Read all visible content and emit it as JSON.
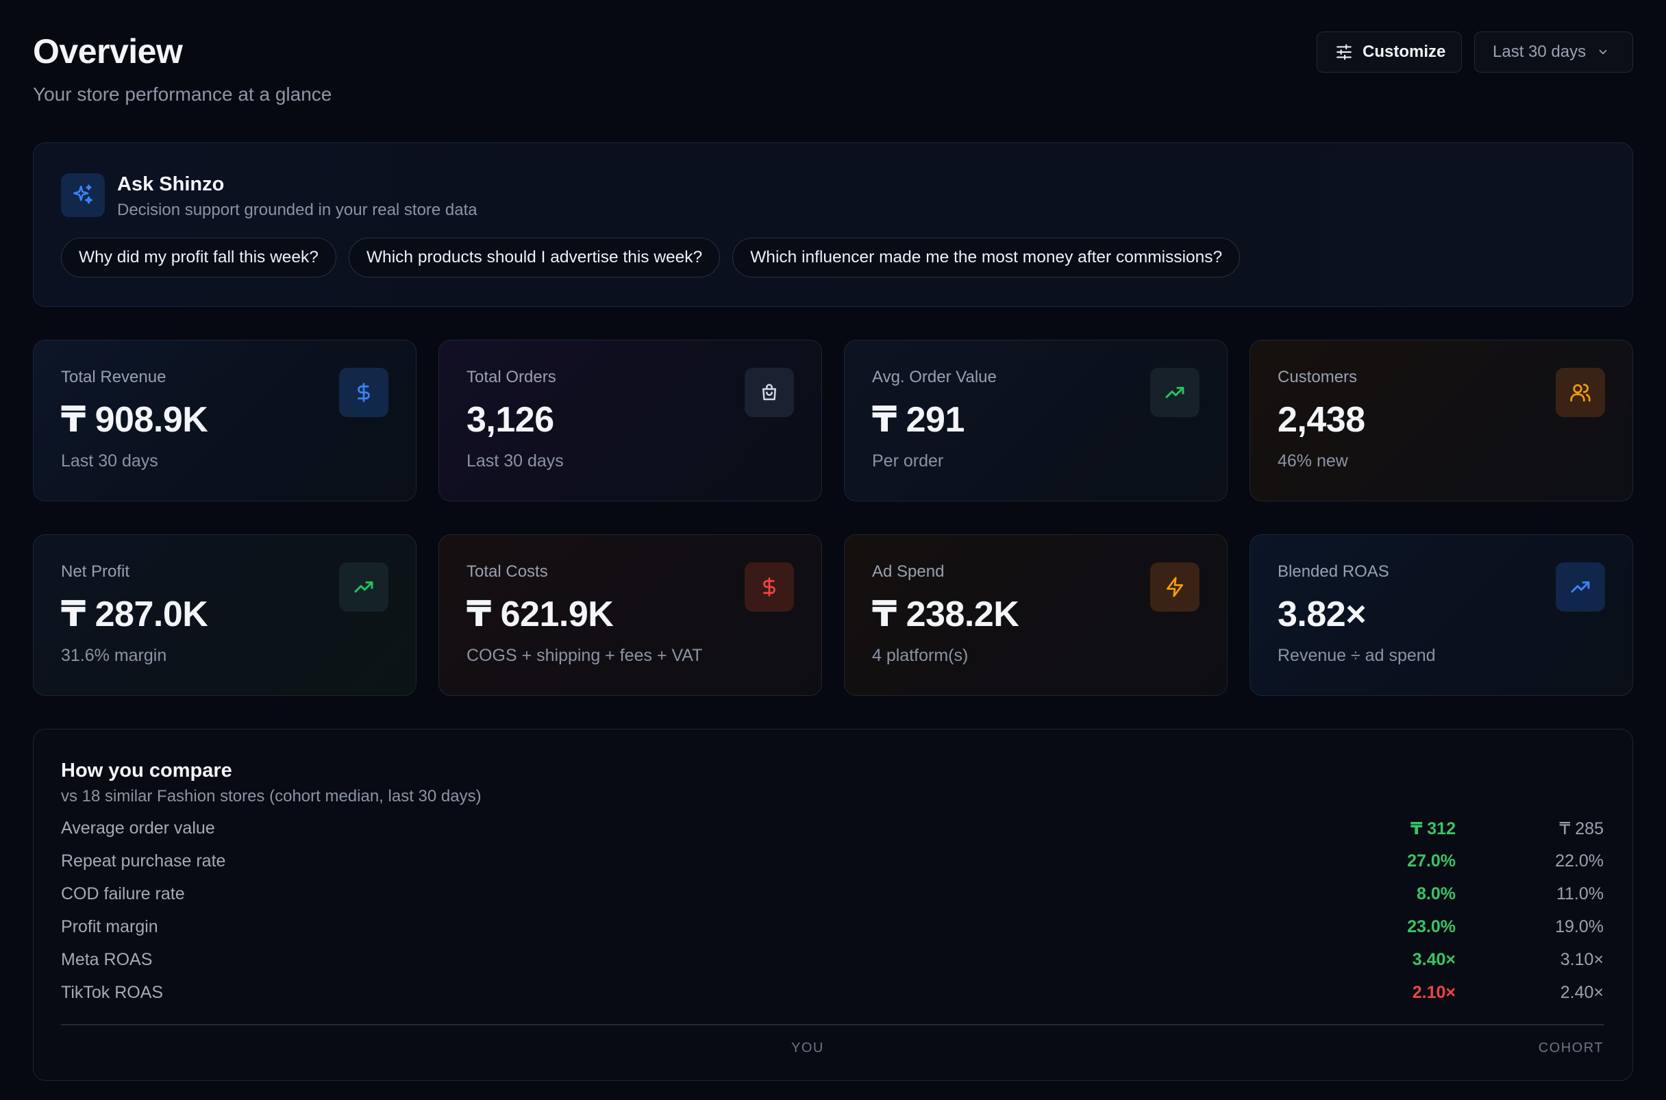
{
  "header": {
    "title": "Overview",
    "subtitle": "Your store performance at a glance",
    "customize_label": "Customize",
    "range_label": "Last 30 days"
  },
  "ask": {
    "title": "Ask Shinzo",
    "description": "Decision support grounded in your real store data",
    "suggestions": [
      "Why did my profit fall this week?",
      "Which products should I advertise this week?",
      "Which influencer made me the most money after commissions?"
    ]
  },
  "stats": [
    {
      "label": "Total Revenue",
      "value": "₸ 908.9K",
      "sub": "Last 30 days",
      "icon": "dollar-icon",
      "accent": "#3b82f6"
    },
    {
      "label": "Total Orders",
      "value": "3,126",
      "sub": "Last 30 days",
      "icon": "shopping-bag-icon",
      "accent": "#c9d1de"
    },
    {
      "label": "Avg. Order Value",
      "value": "₸ 291",
      "sub": "Per order",
      "icon": "trending-up-icon",
      "accent": "#22c55e"
    },
    {
      "label": "Customers",
      "value": "2,438",
      "sub": "46% new",
      "icon": "users-icon",
      "accent": "#f59e0b"
    },
    {
      "label": "Net Profit",
      "value": "₸ 287.0K",
      "sub": "31.6% margin",
      "icon": "trending-up-icon",
      "accent": "#22c55e"
    },
    {
      "label": "Total Costs",
      "value": "₸ 621.9K",
      "sub": "COGS + shipping + fees + VAT",
      "icon": "dollar-icon",
      "accent": "#ef4444"
    },
    {
      "label": "Ad Spend",
      "value": "₸ 238.2K",
      "sub": "4 platform(s)",
      "icon": "lightning-icon",
      "accent": "#f59e0b"
    },
    {
      "label": "Blended ROAS",
      "value": "3.82×",
      "sub": "Revenue ÷ ad spend",
      "icon": "trending-up-icon",
      "accent": "#3b82f6"
    }
  ],
  "compare": {
    "title": "How you compare",
    "subtitle": "vs 18 similar Fashion stores (cohort median, last 30 days)",
    "col_you": "YOU",
    "col_cohort": "COHORT",
    "rows": [
      {
        "metric": "Average order value",
        "you": "₸ 312",
        "cohort": "₸ 285",
        "status": "good"
      },
      {
        "metric": "Repeat purchase rate",
        "you": "27.0%",
        "cohort": "22.0%",
        "status": "good"
      },
      {
        "metric": "COD failure rate",
        "you": "8.0%",
        "cohort": "11.0%",
        "status": "good"
      },
      {
        "metric": "Profit margin",
        "you": "23.0%",
        "cohort": "19.0%",
        "status": "good"
      },
      {
        "metric": "Meta ROAS",
        "you": "3.40×",
        "cohort": "3.10×",
        "status": "good"
      },
      {
        "metric": "TikTok ROAS",
        "you": "2.10×",
        "cohort": "2.40×",
        "status": "bad"
      }
    ]
  },
  "colors": {
    "background": "#060911",
    "good": "#39c466",
    "bad": "#ef4444",
    "blue": "#3b82f6",
    "amber": "#f59e0b",
    "red": "#ef4444"
  }
}
